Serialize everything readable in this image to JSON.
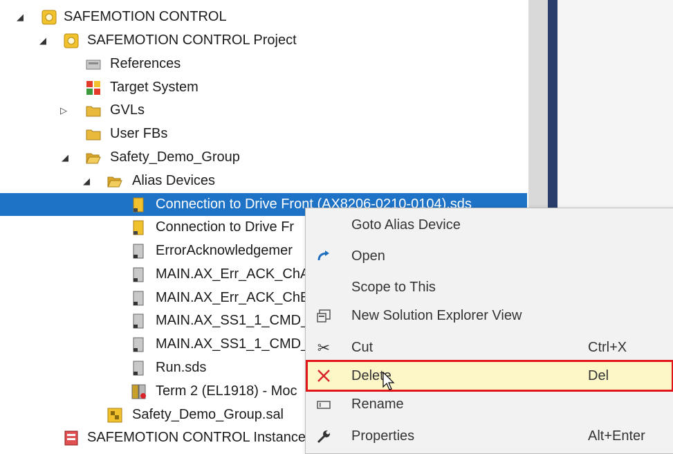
{
  "tree": {
    "items": [
      {
        "label": "SAFEMOTION CONTROL",
        "expander": "expanded",
        "icon": "safety-project-icon"
      },
      {
        "label": "SAFEMOTION CONTROL Project",
        "expander": "expanded",
        "icon": "safety-project-icon"
      },
      {
        "label": "References",
        "expander": "none",
        "icon": "references-icon"
      },
      {
        "label": "Target System",
        "expander": "none",
        "icon": "target-system-icon"
      },
      {
        "label": "GVLs",
        "expander": "collapsed",
        "icon": "folder-icon"
      },
      {
        "label": "User FBs",
        "expander": "none",
        "icon": "folder-icon"
      },
      {
        "label": "Safety_Demo_Group",
        "expander": "expanded",
        "icon": "folder-open-icon"
      },
      {
        "label": "Alias Devices",
        "expander": "expanded",
        "icon": "folder-open-icon"
      },
      {
        "label": "Connection to Drive Front (AX8206-0210-0104).sds",
        "expander": "none",
        "icon": "connection-device-icon",
        "selected": true
      },
      {
        "label": "Connection to Drive Fr",
        "expander": "none",
        "icon": "connection-device-icon"
      },
      {
        "label": "ErrorAcknowledgemer",
        "expander": "none",
        "icon": "alias-device-icon"
      },
      {
        "label": "MAIN.AX_Err_ACK_ChA",
        "expander": "none",
        "icon": "alias-device-icon"
      },
      {
        "label": "MAIN.AX_Err_ACK_ChB",
        "expander": "none",
        "icon": "alias-device-icon"
      },
      {
        "label": "MAIN.AX_SS1_1_CMD_",
        "expander": "none",
        "icon": "alias-device-icon"
      },
      {
        "label": "MAIN.AX_SS1_1_CMD_",
        "expander": "none",
        "icon": "alias-device-icon"
      },
      {
        "label": "Run.sds",
        "expander": "none",
        "icon": "alias-device-icon"
      },
      {
        "label": "Term 2 (EL1918) - Moc",
        "expander": "none",
        "icon": "terminal-icon"
      },
      {
        "label": "Safety_Demo_Group.sal",
        "expander": "none",
        "icon": "safety-group-file-icon"
      },
      {
        "label": "SAFEMOTION CONTROL Instance",
        "expander": "none",
        "icon": "instance-icon"
      }
    ]
  },
  "context_menu": {
    "items": [
      {
        "label": "Goto Alias Device",
        "shortcut": "",
        "icon": ""
      },
      {
        "label": "Open",
        "shortcut": "",
        "icon": "open-icon"
      },
      {
        "label": "Scope to This",
        "shortcut": "",
        "icon": ""
      },
      {
        "label": "New Solution Explorer View",
        "shortcut": "",
        "icon": "new-view-icon"
      },
      {
        "label": "Cut",
        "shortcut": "Ctrl+X",
        "icon": "scissors-icon"
      },
      {
        "label": "Delete",
        "shortcut": "Del",
        "icon": "delete-x-icon",
        "highlighted": true
      },
      {
        "label": "Rename",
        "shortcut": "",
        "icon": "rename-icon"
      },
      {
        "label": "Properties",
        "shortcut": "Alt+Enter",
        "icon": "wrench-icon"
      }
    ]
  },
  "colors": {
    "selection": "#1e73c7",
    "highlight_border": "#e0161b",
    "highlight_fill": "#fdf6c7",
    "folder": "#e8b93a"
  }
}
